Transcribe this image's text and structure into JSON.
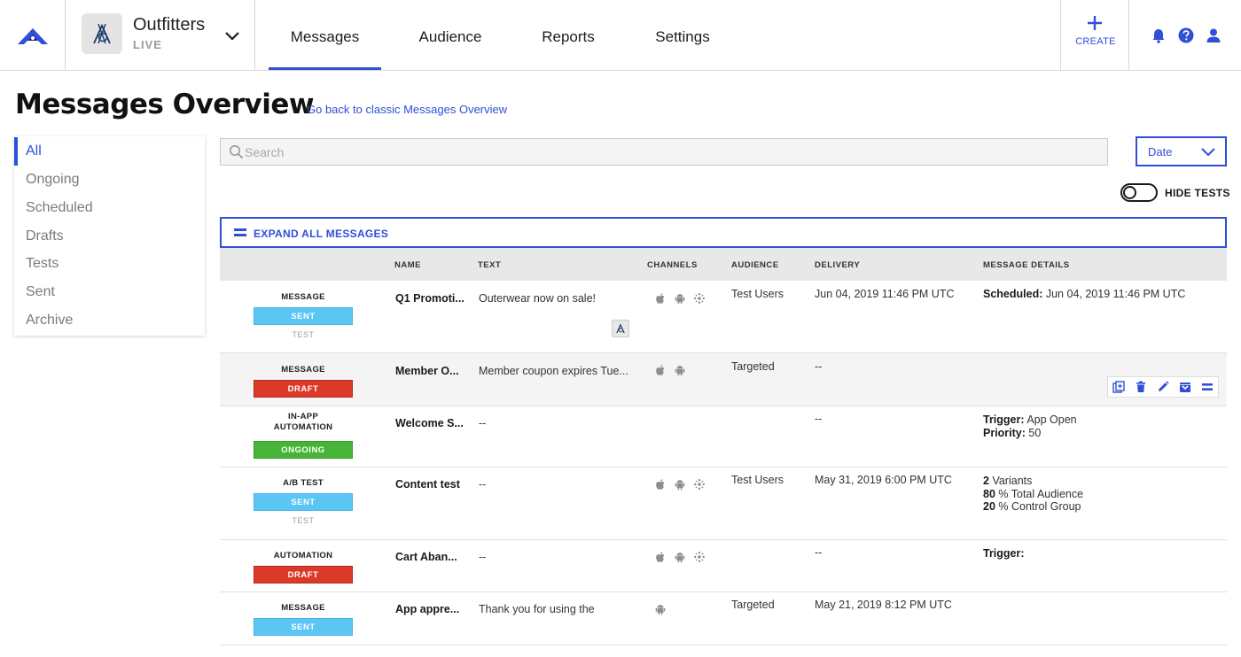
{
  "app": {
    "name": "Outfitters",
    "status": "LIVE"
  },
  "nav": {
    "tabs": [
      {
        "label": "Messages"
      },
      {
        "label": "Audience"
      },
      {
        "label": "Reports"
      },
      {
        "label": "Settings"
      }
    ],
    "create_label": "CREATE"
  },
  "header": {
    "title": "Messages Overview",
    "classic_link": "Go back to classic Messages Overview"
  },
  "filters": [
    "All",
    "Ongoing",
    "Scheduled",
    "Drafts",
    "Tests",
    "Sent",
    "Archive"
  ],
  "search": {
    "placeholder": "Search",
    "value": ""
  },
  "sort": {
    "selected": "Date"
  },
  "toggle": {
    "label": "HIDE TESTS",
    "on": false
  },
  "expand_all": "EXPAND ALL MESSAGES",
  "table": {
    "headers": [
      "NAME",
      "TEXT",
      "CHANNELS",
      "AUDIENCE",
      "DELIVERY",
      "MESSAGE DETAILS"
    ],
    "rows": [
      {
        "type": "MESSAGE",
        "status": "SENT",
        "test": "TEST",
        "name": "Q1 Promoti...",
        "text": "Outerwear now on sale!",
        "audience": "Test Users",
        "delivery": "Jun 04, 2019 11:46 PM UTC",
        "details": [
          {
            "label": "Scheduled:",
            "value": "Jun 04, 2019 11:46 PM UTC"
          }
        ]
      },
      {
        "type": "MESSAGE",
        "status": "DRAFT",
        "name": "Member O...",
        "text": "Member coupon expires Tue...",
        "audience": "Targeted",
        "delivery": "--"
      },
      {
        "type_line1": "IN-APP",
        "type_line2": "AUTOMATION",
        "status": "ONGOING",
        "name": "Welcome S...",
        "text": "--",
        "delivery": "--",
        "details": [
          {
            "label": "Trigger:",
            "value": "App Open"
          },
          {
            "label": "Priority:",
            "value": "50"
          }
        ]
      },
      {
        "type": "A/B TEST",
        "status": "SENT",
        "test": "TEST",
        "name": "Content test",
        "text": "--",
        "audience": "Test Users",
        "delivery": "May 31, 2019 6:00 PM UTC",
        "details": [
          {
            "label": "2",
            "value": "Variants"
          },
          {
            "label": "80",
            "value": "% Total Audience"
          },
          {
            "label": "20",
            "value": "% Control Group"
          }
        ]
      },
      {
        "type": "AUTOMATION",
        "status": "DRAFT",
        "name": "Cart Aban...",
        "text": "--",
        "delivery": "--",
        "details": [
          {
            "label": "Trigger:",
            "value": ""
          }
        ]
      },
      {
        "type": "MESSAGE",
        "status": "SENT",
        "name": "App appre...",
        "text": "Thank you for using the",
        "audience": "Targeted",
        "delivery": "May 21, 2019 8:12 PM UTC"
      }
    ]
  },
  "colors": {
    "accent": "#2f4fd9",
    "sent": "#5bc6f4",
    "draft": "#dc3a28",
    "ongoing": "#46b437"
  }
}
